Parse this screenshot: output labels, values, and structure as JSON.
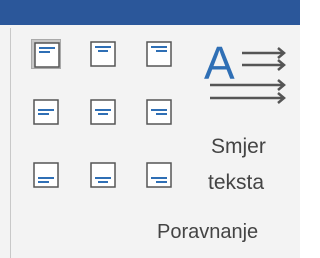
{
  "ribbon": {
    "accent_color": "#2b579a",
    "group_label": "Poravnanje",
    "alignment_buttons": [
      {
        "name": "align-top-left",
        "icon": "align-top-left-icon",
        "selected": true
      },
      {
        "name": "align-top-center",
        "icon": "align-top-center-icon",
        "selected": false
      },
      {
        "name": "align-top-right",
        "icon": "align-top-right-icon",
        "selected": false
      },
      {
        "name": "align-middle-left",
        "icon": "align-middle-left-icon",
        "selected": false
      },
      {
        "name": "align-middle-center",
        "icon": "align-middle-center-icon",
        "selected": false
      },
      {
        "name": "align-middle-right",
        "icon": "align-middle-right-icon",
        "selected": false
      },
      {
        "name": "align-bottom-left",
        "icon": "align-bottom-left-icon",
        "selected": false
      },
      {
        "name": "align-bottom-center",
        "icon": "align-bottom-center-icon",
        "selected": false
      },
      {
        "name": "align-bottom-right",
        "icon": "align-bottom-right-icon",
        "selected": false
      }
    ],
    "text_direction": {
      "label_line1": "Smjer",
      "label_line2": "teksta",
      "icon_glyph": "A",
      "icon": "text-direction-icon"
    }
  }
}
